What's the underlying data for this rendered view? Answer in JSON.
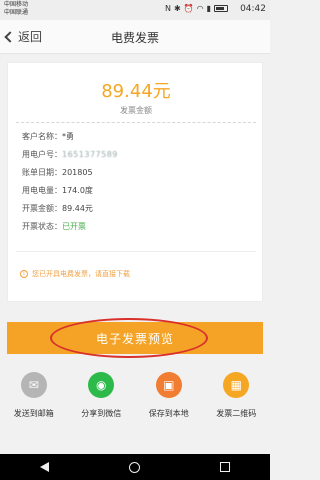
{
  "status_bar": {
    "carrier1": "中国移动",
    "carrier2": "中国联通",
    "time": "04:42"
  },
  "nav": {
    "back_label": "返回",
    "title": "电费发票"
  },
  "invoice": {
    "amount": "89.44元",
    "amount_label": "发票金额",
    "rows": [
      {
        "label": "客户名称：",
        "value": "*勇"
      },
      {
        "label": "用电户号：",
        "value": "1651377589"
      },
      {
        "label": "账单日期：",
        "value": "201805"
      },
      {
        "label": "用电电量：",
        "value": "174.0度"
      },
      {
        "label": "开票金额：",
        "value": "89.44元"
      },
      {
        "label": "开票状态：",
        "value": "已开票"
      }
    ],
    "note": "您已开具电费发票，请直接下载"
  },
  "preview_button": "电子发票预览",
  "actions": [
    {
      "label": "发送到邮箱",
      "icon": "mail-icon",
      "color": "#b5b5b5"
    },
    {
      "label": "分享到微信",
      "icon": "wechat-icon",
      "color": "#2dba4a"
    },
    {
      "label": "保存到本地",
      "icon": "save-icon",
      "color": "#f07d32"
    },
    {
      "label": "发票二维码",
      "icon": "qrcode-icon",
      "color": "#f5a623"
    }
  ]
}
